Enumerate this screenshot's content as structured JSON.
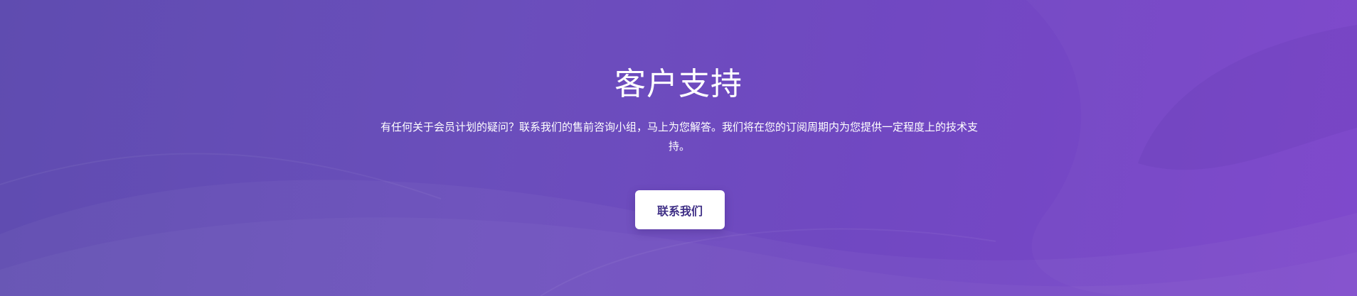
{
  "support": {
    "title": "客户支持",
    "description": "有任何关于会员计划的疑问？联系我们的售前咨询小组，马上为您解答。我们将在您的订阅周期内为您提供一定程度上的技术支持。",
    "button_label": "联系我们"
  },
  "colors": {
    "background_start": "#5f4cb0",
    "background_end": "#7c45cb",
    "button_background": "#ffffff",
    "button_text": "#3f2f86",
    "text": "#ffffff"
  }
}
